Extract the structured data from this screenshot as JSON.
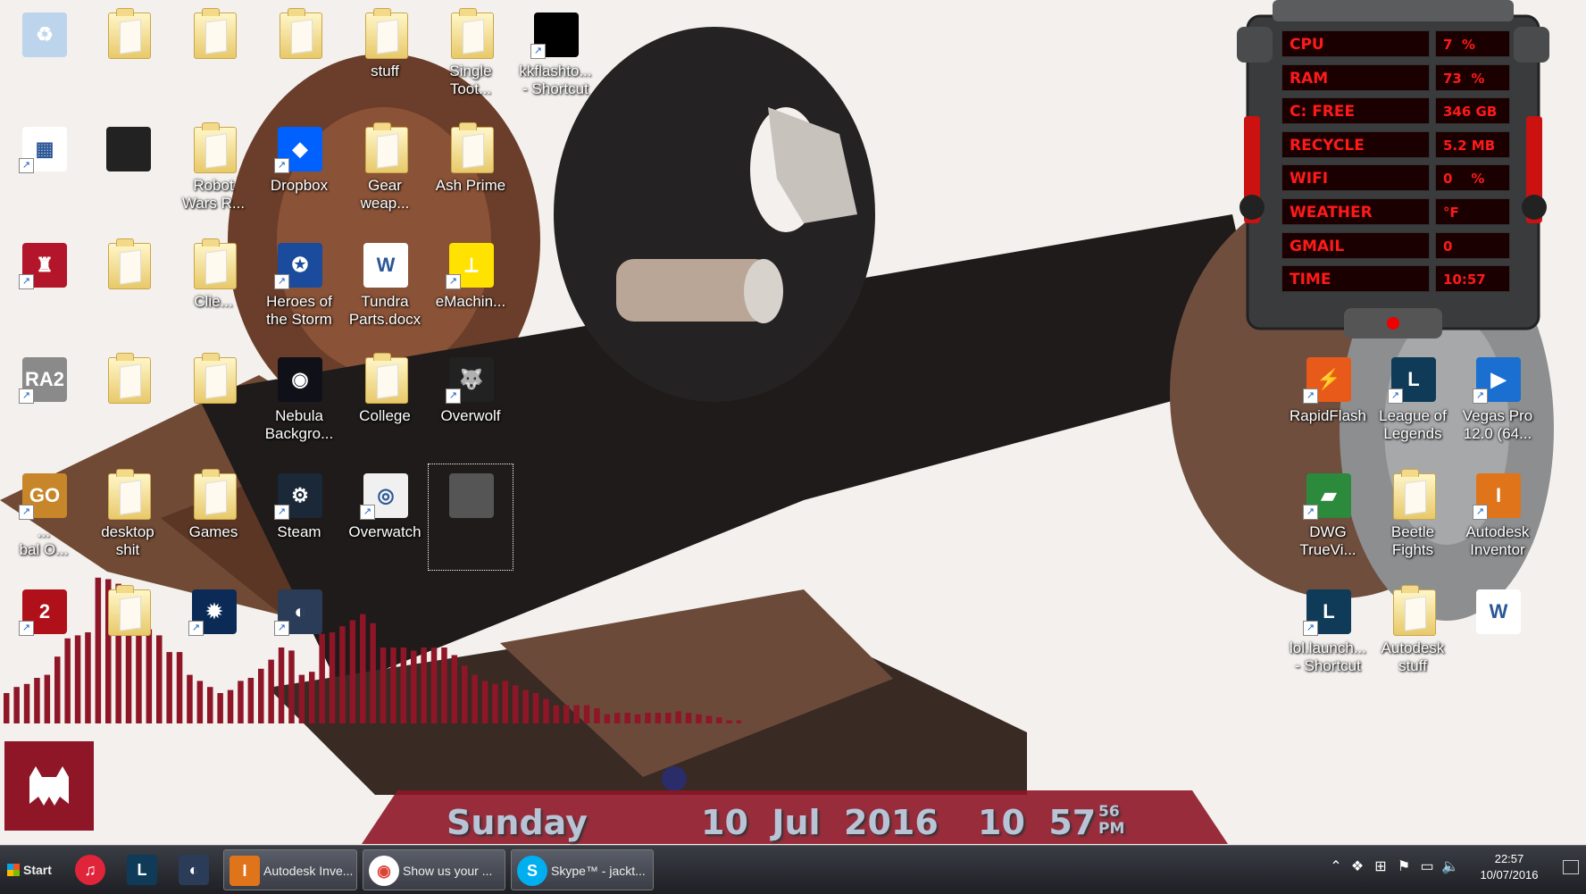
{
  "desktop": {
    "icons": [
      {
        "label": "",
        "kind": "recycle-bin"
      },
      {
        "label": "",
        "kind": "folder"
      },
      {
        "label": "",
        "kind": "folder"
      },
      {
        "label": "",
        "kind": "folder"
      },
      {
        "label": "stuff",
        "kind": "folder"
      },
      {
        "label": "Single\nToot...",
        "kind": "folder"
      },
      {
        "label": "kkflashto...\n- Shortcut",
        "kind": "shortcut"
      },
      {
        "label": "",
        "kind": "app-grid"
      },
      {
        "label": "",
        "kind": "image"
      },
      {
        "label": "Robot\nWars R...",
        "kind": "folder"
      },
      {
        "label": "Dropbox",
        "kind": "dropbox"
      },
      {
        "label": "Gear\nweap...",
        "kind": "folder"
      },
      {
        "label": "Ash Prime",
        "kind": "folder"
      },
      {
        "label": "",
        "kind": "castle"
      },
      {
        "label": "",
        "kind": "folder"
      },
      {
        "label": "Clie...",
        "kind": "folder"
      },
      {
        "label": "Heroes of\nthe Storm",
        "kind": "heroes"
      },
      {
        "label": "Tundra\nParts.docx",
        "kind": "word"
      },
      {
        "label": "eMachin...",
        "kind": "emachine"
      },
      {
        "label": "",
        "kind": "ra2"
      },
      {
        "label": "",
        "kind": "folder"
      },
      {
        "label": "",
        "kind": "folder"
      },
      {
        "label": "Nebula\nBackgro...",
        "kind": "nebula"
      },
      {
        "label": "College",
        "kind": "folder"
      },
      {
        "label": "Overwolf",
        "kind": "overwolf"
      },
      {
        "label": "...\nbal O...",
        "kind": "csgo"
      },
      {
        "label": "desktop\nshit",
        "kind": "folder"
      },
      {
        "label": "Games",
        "kind": "folder"
      },
      {
        "label": "Steam",
        "kind": "steam"
      },
      {
        "label": "Overwatch",
        "kind": "overwatch"
      },
      {
        "label": "",
        "kind": "image-selected"
      },
      {
        "label": "",
        "kind": "gw2"
      },
      {
        "label": "",
        "kind": "folder"
      },
      {
        "label": "",
        "kind": "battlenet"
      },
      {
        "label": "",
        "kind": "teamspeak"
      },
      {
        "label": "RapidFlash",
        "kind": "rapidflash"
      },
      {
        "label": "League of\nLegends",
        "kind": "lol"
      },
      {
        "label": "Vegas Pro\n12.0 (64...",
        "kind": "vegas"
      },
      {
        "label": "DWG\nTrueVi...",
        "kind": "dwg"
      },
      {
        "label": "Beetle\nFights",
        "kind": "folder"
      },
      {
        "label": "Autodesk\nInventor",
        "kind": "inventor"
      },
      {
        "label": "lol.launch...\n- Shortcut",
        "kind": "lol"
      },
      {
        "label": "Autodesk\nstuff",
        "kind": "folder"
      },
      {
        "label": "",
        "kind": "word"
      }
    ]
  },
  "meter": {
    "rows": [
      {
        "label": "CPU",
        "value": "7  %"
      },
      {
        "label": "RAM",
        "value": "73  %"
      },
      {
        "label": "C: FREE",
        "value": "346 GB"
      },
      {
        "label": "RECYCLE",
        "value": "5.2 MB"
      },
      {
        "label": "WIFI",
        "value": "0    %"
      },
      {
        "label": "WEATHER",
        "value": "°F"
      },
      {
        "label": "GMAIL",
        "value": "0"
      },
      {
        "label": "TIME",
        "value": "10:57"
      }
    ],
    "accent": "#ff1a1a"
  },
  "visualizer": {
    "color": "#8e1627",
    "levels": [
      0.2,
      0.24,
      0.26,
      0.3,
      0.32,
      0.44,
      0.56,
      0.58,
      0.6,
      0.96,
      0.95,
      0.92,
      0.9,
      0.68,
      0.62,
      0.58,
      0.47,
      0.47,
      0.32,
      0.28,
      0.24,
      0.2,
      0.22,
      0.28,
      0.3,
      0.36,
      0.42,
      0.5,
      0.48,
      0.32,
      0.34,
      0.59,
      0.6,
      0.64,
      0.68,
      0.72,
      0.66,
      0.5,
      0.5,
      0.5,
      0.48,
      0.5,
      0.5,
      0.5,
      0.45,
      0.38,
      0.32,
      0.28,
      0.26,
      0.28,
      0.25,
      0.22,
      0.2,
      0.16,
      0.12,
      0.12,
      0.12,
      0.12,
      0.1,
      0.06,
      0.07,
      0.07,
      0.06,
      0.07,
      0.07,
      0.07,
      0.08,
      0.07,
      0.06,
      0.05,
      0.04,
      0.02,
      0.02
    ]
  },
  "clock": {
    "day": "Sunday",
    "date": "10  Jul  2016",
    "time": "10  57",
    "seconds": "56",
    "ampm": "PM"
  },
  "taskbar": {
    "start_label": "Start",
    "buttons": [
      {
        "label": "",
        "kind": "itunes"
      },
      {
        "label": "",
        "kind": "lol"
      },
      {
        "label": "",
        "kind": "teamspeak"
      },
      {
        "label": "Autodesk Inve...",
        "kind": "inventor"
      },
      {
        "label": "Show us your ...",
        "kind": "chrome"
      },
      {
        "label": "Skype™ - jackt...",
        "kind": "skype"
      }
    ],
    "clock_time": "22:57",
    "clock_date": "10/07/2016"
  }
}
